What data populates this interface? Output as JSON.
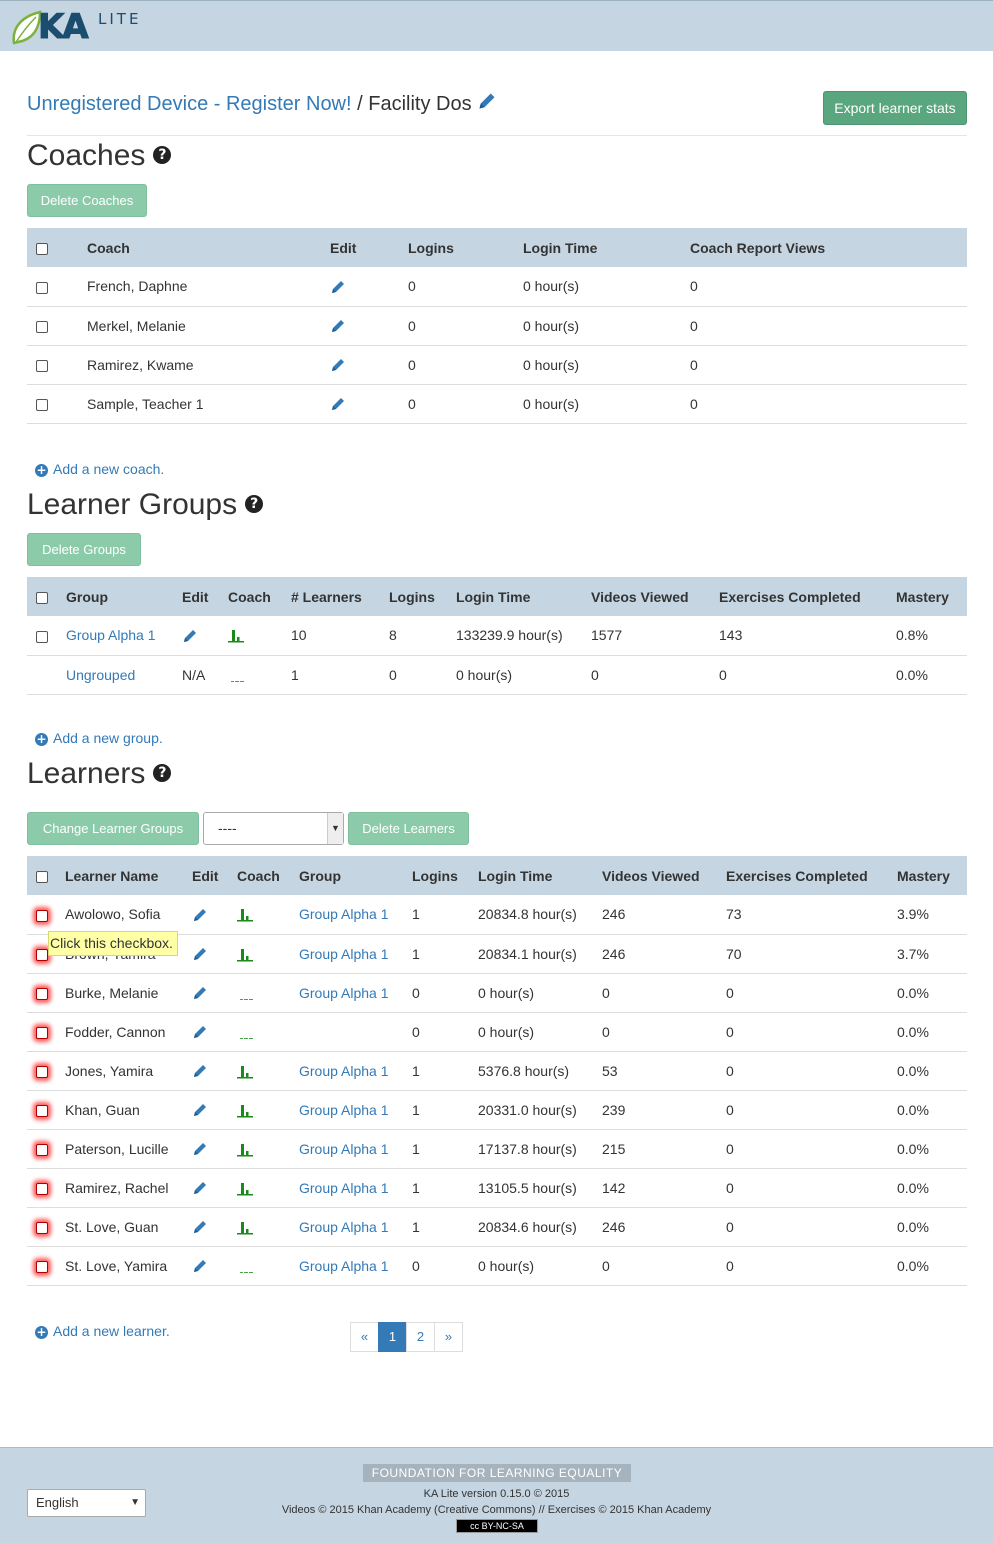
{
  "header": {
    "logo_text": "KA",
    "logo_sub": "LITE",
    "register_link": "Unregistered Device - Register Now!",
    "breadcrumb_sep": "/",
    "facility": "Facility Dos",
    "export_label": "Export learner stats"
  },
  "coaches": {
    "title": "Coaches",
    "help": "?",
    "delete_label": "Delete Coaches",
    "columns": [
      "Coach",
      "Edit",
      "Logins",
      "Login Time",
      "Coach Report Views"
    ],
    "rows": [
      {
        "name": "French, Daphne",
        "logins": "0",
        "time": "0 hour(s)",
        "views": "0"
      },
      {
        "name": "Merkel, Melanie",
        "logins": "0",
        "time": "0 hour(s)",
        "views": "0"
      },
      {
        "name": "Ramirez, Kwame",
        "logins": "0",
        "time": "0 hour(s)",
        "views": "0"
      },
      {
        "name": "Sample, Teacher 1",
        "logins": "0",
        "time": "0 hour(s)",
        "views": "0"
      }
    ],
    "add_label": "Add a new coach."
  },
  "groups": {
    "title": "Learner Groups",
    "help": "?",
    "delete_label": "Delete Groups",
    "columns": [
      "Group",
      "Edit",
      "Coach",
      "# Learners",
      "Logins",
      "Login Time",
      "Videos Viewed",
      "Exercises Completed",
      "Mastery"
    ],
    "rows": [
      {
        "name": "Group Alpha 1",
        "edit": "",
        "learners": "10",
        "logins": "8",
        "time": "133239.9 hour(s)",
        "videos": "1577",
        "exercises": "143",
        "mastery": "0.8%"
      },
      {
        "name": "Ungrouped",
        "edit": "N/A",
        "learners": "1",
        "logins": "0",
        "time": "0 hour(s)",
        "videos": "0",
        "exercises": "0",
        "mastery": "0.0%"
      }
    ],
    "add_label": "Add a new group."
  },
  "learners": {
    "title": "Learners",
    "help": "?",
    "change_label": "Change Learner Groups",
    "select_value": "----",
    "delete_label": "Delete Learners",
    "columns": [
      "Learner Name",
      "Edit",
      "Coach",
      "Group",
      "Logins",
      "Login Time",
      "Videos Viewed",
      "Exercises Completed",
      "Mastery"
    ],
    "rows": [
      {
        "name": "Awolowo, Sofia",
        "group": "Group Alpha 1",
        "logins": "1",
        "time": "20834.8 hour(s)",
        "videos": "246",
        "exercises": "73",
        "mastery": "3.9%"
      },
      {
        "name": "Brown, Yamira",
        "group": "Group Alpha 1",
        "logins": "1",
        "time": "20834.1 hour(s)",
        "videos": "246",
        "exercises": "70",
        "mastery": "3.7%"
      },
      {
        "name": "Burke, Melanie",
        "group": "Group Alpha 1",
        "logins": "0",
        "time": "0 hour(s)",
        "videos": "0",
        "exercises": "0",
        "mastery": "0.0%"
      },
      {
        "name": "Fodder, Cannon",
        "group": "",
        "logins": "0",
        "time": "0 hour(s)",
        "videos": "0",
        "exercises": "0",
        "mastery": "0.0%"
      },
      {
        "name": "Jones, Yamira",
        "group": "Group Alpha 1",
        "logins": "1",
        "time": "5376.8 hour(s)",
        "videos": "53",
        "exercises": "0",
        "mastery": "0.0%"
      },
      {
        "name": "Khan, Guan",
        "group": "Group Alpha 1",
        "logins": "1",
        "time": "20331.0 hour(s)",
        "videos": "239",
        "exercises": "0",
        "mastery": "0.0%"
      },
      {
        "name": "Paterson, Lucille",
        "group": "Group Alpha 1",
        "logins": "1",
        "time": "17137.8 hour(s)",
        "videos": "215",
        "exercises": "0",
        "mastery": "0.0%"
      },
      {
        "name": "Ramirez, Rachel",
        "group": "Group Alpha 1",
        "logins": "1",
        "time": "13105.5 hour(s)",
        "videos": "142",
        "exercises": "0",
        "mastery": "0.0%"
      },
      {
        "name": "St. Love, Guan",
        "group": "Group Alpha 1",
        "logins": "1",
        "time": "20834.6 hour(s)",
        "videos": "246",
        "exercises": "0",
        "mastery": "0.0%"
      },
      {
        "name": "St. Love, Yamira",
        "group": "Group Alpha 1",
        "logins": "0",
        "time": "0 hour(s)",
        "videos": "0",
        "exercises": "0",
        "mastery": "0.0%"
      }
    ],
    "add_label": "Add a new learner.",
    "tooltip": "Click this checkbox."
  },
  "pagination": {
    "prev": "«",
    "pages": [
      "1",
      "2"
    ],
    "next": "»",
    "active": "1"
  },
  "footer": {
    "org": "FOUNDATION FOR LEARNING EQUALITY",
    "version": "KA Lite version 0.15.0 © 2015",
    "copyright": "Videos © 2015 Khan Academy (Creative Commons) // Exercises © 2015 Khan Academy",
    "license_badge": "cc BY-NC-SA",
    "language": "English"
  },
  "colors": {
    "accent": "#337ab7",
    "brand_bar": "#c5d5e1",
    "button_green": "#5aa67f",
    "sparkline_green": "#1a8a1a"
  }
}
